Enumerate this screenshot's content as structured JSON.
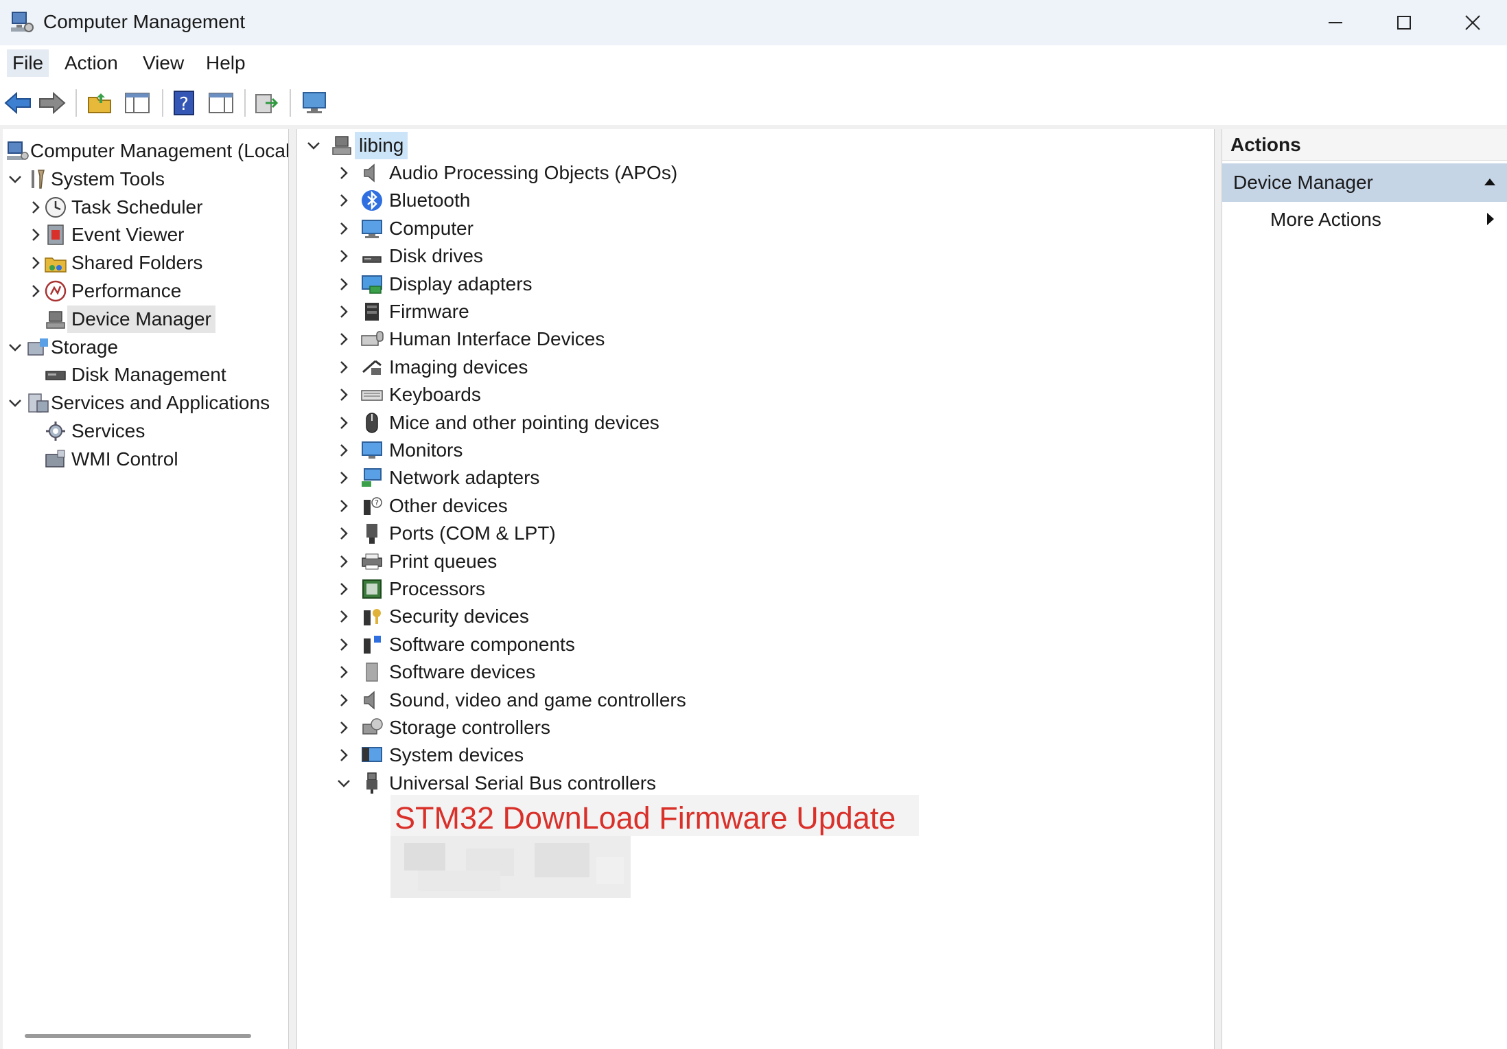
{
  "window": {
    "title": "Computer Management"
  },
  "menu": {
    "items": [
      {
        "label": "File",
        "active": true
      },
      {
        "label": "Action",
        "active": false
      },
      {
        "label": "View",
        "active": false
      },
      {
        "label": "Help",
        "active": false
      }
    ]
  },
  "toolbar": {
    "buttons": [
      "back-arrow-icon",
      "forward-arrow-icon",
      "up-folder-icon",
      "console-tree-icon",
      "help-icon",
      "properties-pane-icon",
      "export-list-icon",
      "monitor-icon"
    ]
  },
  "left_tree": {
    "items": [
      {
        "label": "Computer Management (Local",
        "level": 0,
        "expand": "none",
        "icon": "computer-management-icon",
        "selected": false
      },
      {
        "label": "System Tools",
        "level": 1,
        "expand": "open",
        "icon": "system-tools-icon",
        "selected": false
      },
      {
        "label": "Task Scheduler",
        "level": 2,
        "expand": "closed",
        "icon": "clock-icon",
        "selected": false
      },
      {
        "label": "Event Viewer",
        "level": 2,
        "expand": "closed",
        "icon": "event-viewer-icon",
        "selected": false
      },
      {
        "label": "Shared Folders",
        "level": 2,
        "expand": "closed",
        "icon": "shared-folder-icon",
        "selected": false
      },
      {
        "label": "Performance",
        "level": 2,
        "expand": "closed",
        "icon": "performance-icon",
        "selected": false
      },
      {
        "label": "Device Manager",
        "level": 2,
        "expand": "none",
        "icon": "device-manager-icon",
        "selected": true
      },
      {
        "label": "Storage",
        "level": 1,
        "expand": "open",
        "icon": "storage-icon",
        "selected": false
      },
      {
        "label": "Disk Management",
        "level": 2,
        "expand": "none",
        "icon": "disk-management-icon",
        "selected": false
      },
      {
        "label": "Services and Applications",
        "level": 1,
        "expand": "open",
        "icon": "services-apps-icon",
        "selected": false
      },
      {
        "label": "Services",
        "level": 2,
        "expand": "none",
        "icon": "gear-icon",
        "selected": false
      },
      {
        "label": "WMI Control",
        "level": 2,
        "expand": "none",
        "icon": "wmi-control-icon",
        "selected": false
      }
    ]
  },
  "device_tree": {
    "root": "libing",
    "categories": [
      {
        "label": "Audio Processing Objects (APOs)",
        "icon": "speaker-icon",
        "expand": "closed"
      },
      {
        "label": "Bluetooth",
        "icon": "bluetooth-icon",
        "expand": "closed"
      },
      {
        "label": "Computer",
        "icon": "computer-icon",
        "expand": "closed"
      },
      {
        "label": "Disk drives",
        "icon": "disk-drive-icon",
        "expand": "closed"
      },
      {
        "label": "Display adapters",
        "icon": "display-adapter-icon",
        "expand": "closed"
      },
      {
        "label": "Firmware",
        "icon": "firmware-icon",
        "expand": "closed"
      },
      {
        "label": "Human Interface Devices",
        "icon": "hid-icon",
        "expand": "closed"
      },
      {
        "label": "Imaging devices",
        "icon": "camera-icon",
        "expand": "closed"
      },
      {
        "label": "Keyboards",
        "icon": "keyboard-icon",
        "expand": "closed"
      },
      {
        "label": "Mice and other pointing devices",
        "icon": "mouse-icon",
        "expand": "closed"
      },
      {
        "label": "Monitors",
        "icon": "monitor-icon",
        "expand": "closed"
      },
      {
        "label": "Network adapters",
        "icon": "network-adapter-icon",
        "expand": "closed"
      },
      {
        "label": "Other devices",
        "icon": "other-devices-icon",
        "expand": "closed"
      },
      {
        "label": "Ports (COM & LPT)",
        "icon": "port-icon",
        "expand": "closed"
      },
      {
        "label": "Print queues",
        "icon": "printer-icon",
        "expand": "closed"
      },
      {
        "label": "Processors",
        "icon": "processor-icon",
        "expand": "closed"
      },
      {
        "label": "Security devices",
        "icon": "security-device-icon",
        "expand": "closed"
      },
      {
        "label": "Software components",
        "icon": "software-component-icon",
        "expand": "closed"
      },
      {
        "label": "Software devices",
        "icon": "software-device-icon",
        "expand": "closed"
      },
      {
        "label": "Sound, video and game controllers",
        "icon": "speaker-icon",
        "expand": "closed"
      },
      {
        "label": "Storage controllers",
        "icon": "storage-controller-icon",
        "expand": "closed"
      },
      {
        "label": "System devices",
        "icon": "system-device-icon",
        "expand": "closed"
      },
      {
        "label": "Universal Serial Bus controllers",
        "icon": "usb-icon",
        "expand": "open"
      }
    ],
    "overlay_text": "STM32 DownLoad Firmware Update"
  },
  "actions": {
    "header": "Actions",
    "section": "Device Manager",
    "more": "More Actions"
  },
  "colors": {
    "titlebar": "#eef3f9",
    "selection": "#e5e5e5",
    "root_highlight": "#cce4f7",
    "actions_section": "#c5d5e6",
    "overlay_red": "#d9302a"
  }
}
